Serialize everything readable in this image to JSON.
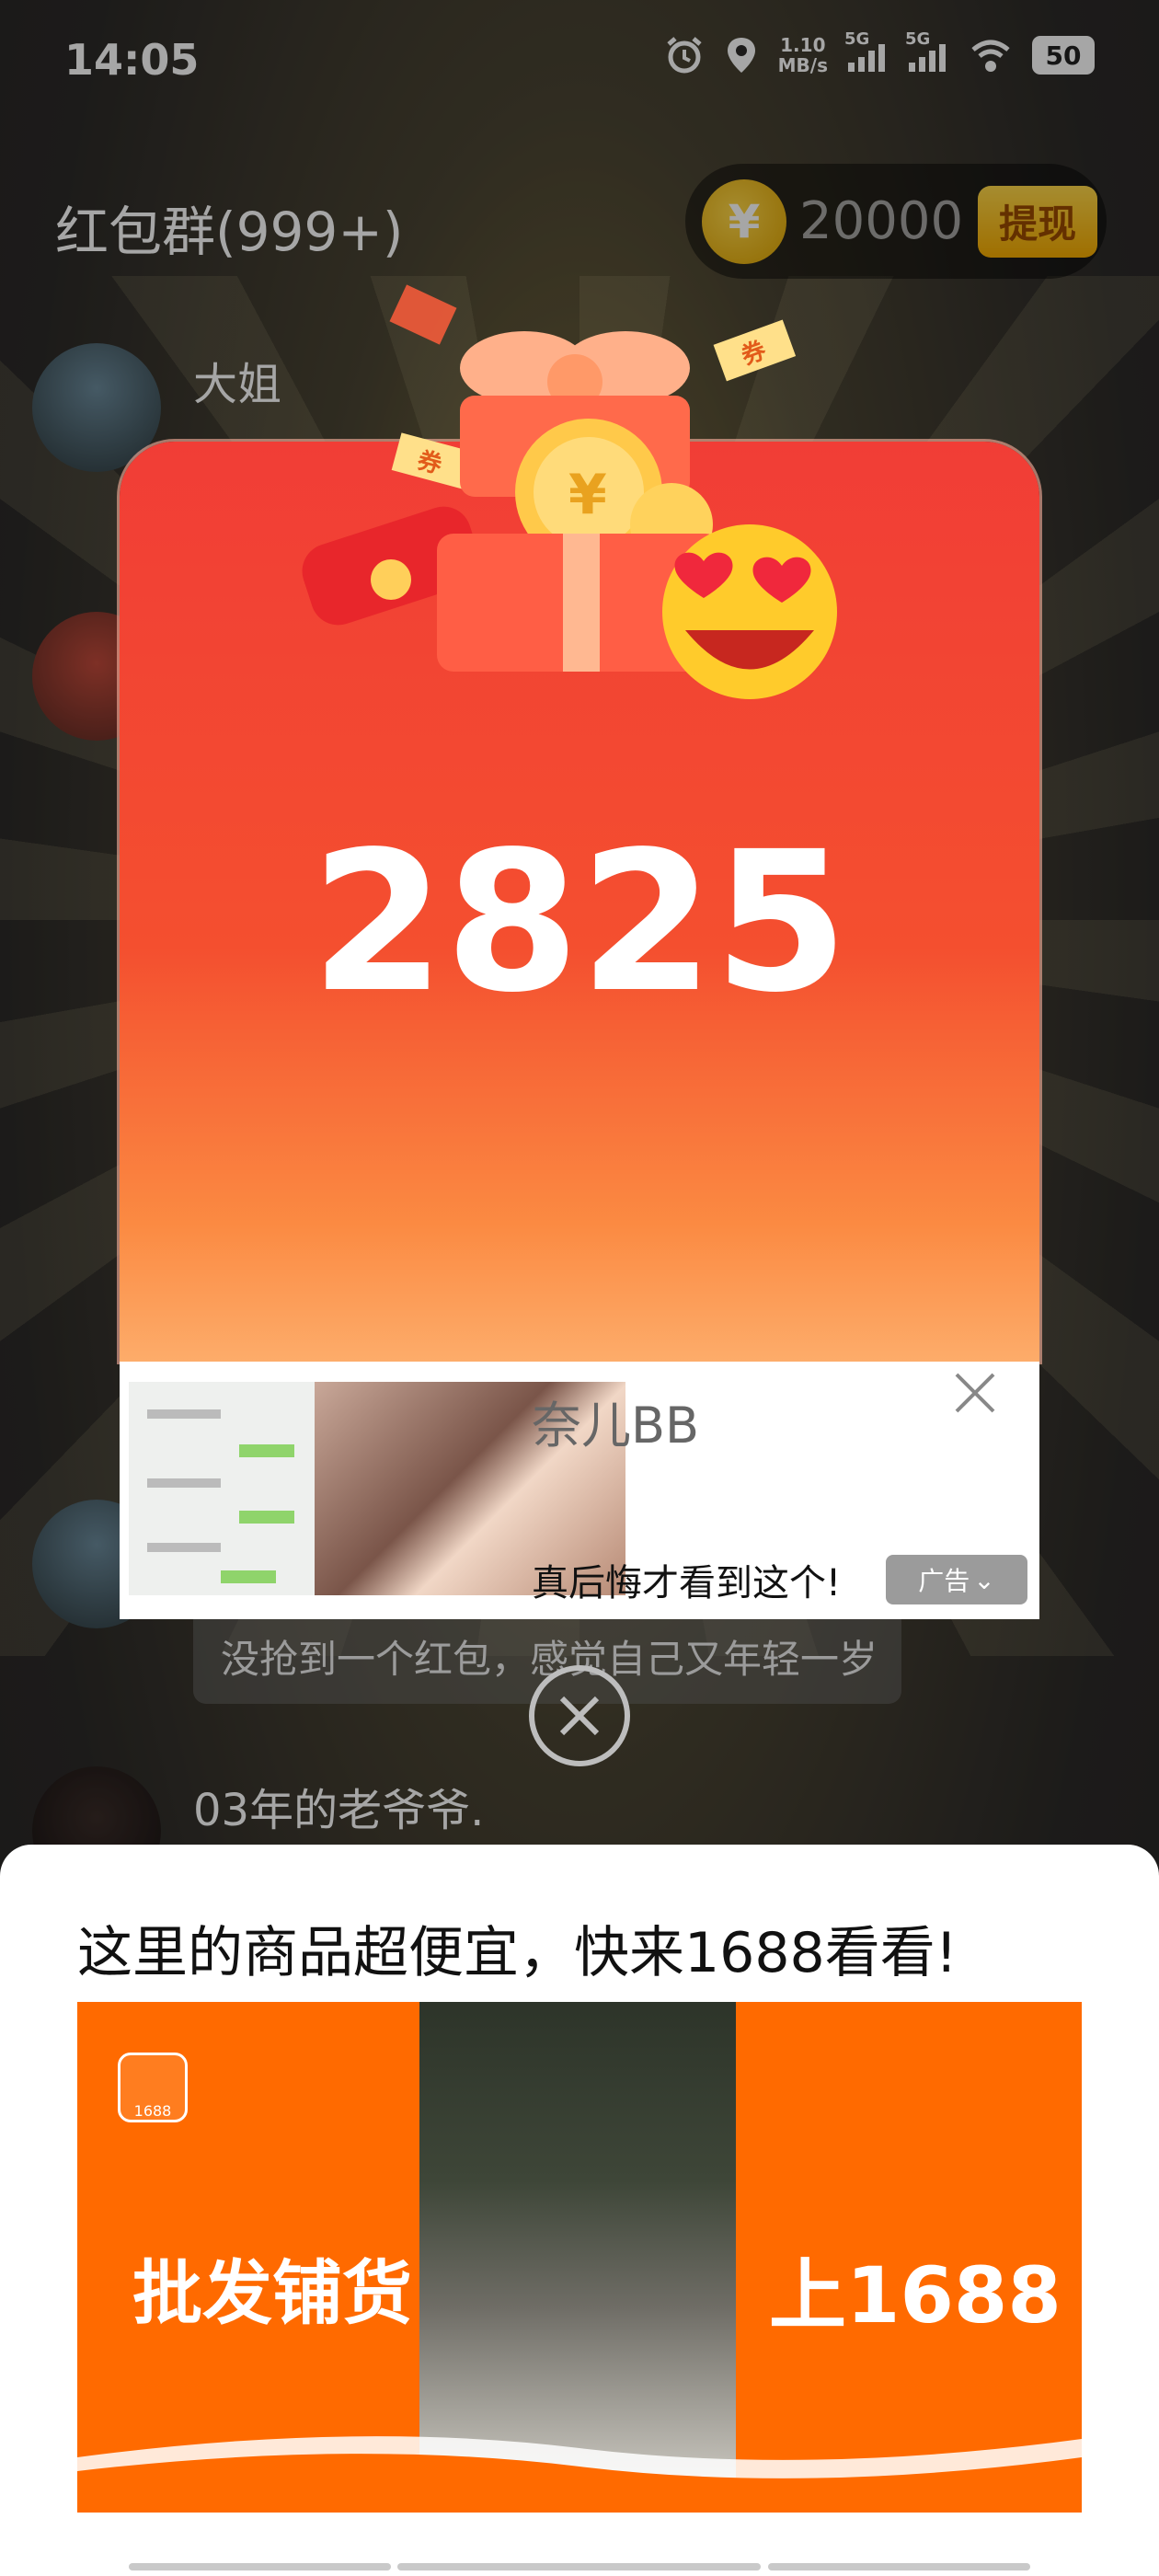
{
  "status_bar": {
    "time": "14:05",
    "net_speed_value": "1.10",
    "net_speed_unit": "MB/s",
    "signal_1": "5G",
    "signal_2": "5G",
    "battery": "50",
    "icons": [
      "alarm-icon",
      "location-icon",
      "signal-icon",
      "signal-icon",
      "wifi-icon",
      "battery-icon"
    ]
  },
  "header": {
    "group_title": "红包群(999+)",
    "coin_symbol": "¥",
    "coin_amount": "20000",
    "withdraw_label": "提现"
  },
  "chat": {
    "first_sender": "大姐",
    "bubble_text": "没抢到一个红包，感觉自己又年轻一岁",
    "last_sender": "03年的老爷爷."
  },
  "dialog": {
    "amount": "2825",
    "coupon_label": "券"
  },
  "ad": {
    "title": "奈儿BB",
    "description": "真后悔才看到这个!",
    "badge": "广告"
  },
  "bottom_sheet": {
    "title": "这里的商品超便宜，快来1688看看!",
    "banner_left": "批发铺货",
    "banner_right": "上1688",
    "logo_text": "1688"
  },
  "colors": {
    "card_top": "#f13d36",
    "card_bottom": "#fdac6a",
    "banner_orange": "#ff6a00",
    "coin_gold": "#ffd84a"
  }
}
